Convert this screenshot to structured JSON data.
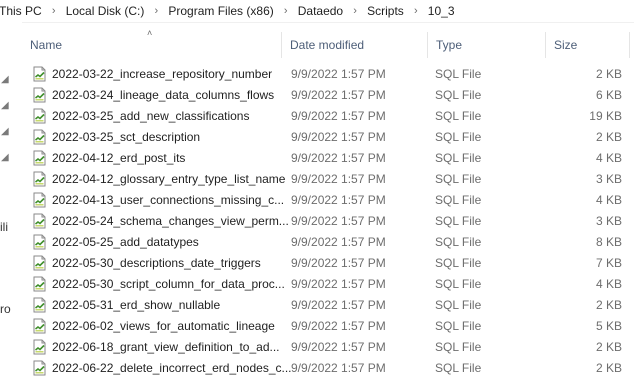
{
  "breadcrumb": [
    "This PC",
    "Local Disk (C:)",
    "Program Files (x86)",
    "Dataedo",
    "Scripts",
    "10_3"
  ],
  "left_pane": {
    "fragment_1": "ili",
    "fragment_2": "ro"
  },
  "columns": {
    "name": "Name",
    "date_modified": "Date modified",
    "type": "Type",
    "size": "Size"
  },
  "files": [
    {
      "name": "2022-03-22_increase_repository_number",
      "date": "9/9/2022 1:57 PM",
      "type": "SQL File",
      "size": "2 KB"
    },
    {
      "name": "2022-03-24_lineage_data_columns_flows",
      "date": "9/9/2022 1:57 PM",
      "type": "SQL File",
      "size": "6 KB"
    },
    {
      "name": "2022-03-25_add_new_classifications",
      "date": "9/9/2022 1:57 PM",
      "type": "SQL File",
      "size": "19 KB"
    },
    {
      "name": "2022-03-25_sct_description",
      "date": "9/9/2022 1:57 PM",
      "type": "SQL File",
      "size": "2 KB"
    },
    {
      "name": "2022-04-12_erd_post_its",
      "date": "9/9/2022 1:57 PM",
      "type": "SQL File",
      "size": "4 KB"
    },
    {
      "name": "2022-04-12_glossary_entry_type_list_name",
      "date": "9/9/2022 1:57 PM",
      "type": "SQL File",
      "size": "3 KB"
    },
    {
      "name": "2022-04-13_user_connections_missing_c...",
      "date": "9/9/2022 1:57 PM",
      "type": "SQL File",
      "size": "4 KB"
    },
    {
      "name": "2022-05-24_schema_changes_view_perm...",
      "date": "9/9/2022 1:57 PM",
      "type": "SQL File",
      "size": "3 KB"
    },
    {
      "name": "2022-05-25_add_datatypes",
      "date": "9/9/2022 1:57 PM",
      "type": "SQL File",
      "size": "8 KB"
    },
    {
      "name": "2022-05-30_descriptions_date_triggers",
      "date": "9/9/2022 1:57 PM",
      "type": "SQL File",
      "size": "7 KB"
    },
    {
      "name": "2022-05-30_script_column_for_data_proc...",
      "date": "9/9/2022 1:57 PM",
      "type": "SQL File",
      "size": "4 KB"
    },
    {
      "name": "2022-05-31_erd_show_nullable",
      "date": "9/9/2022 1:57 PM",
      "type": "SQL File",
      "size": "2 KB"
    },
    {
      "name": "2022-06-02_views_for_automatic_lineage",
      "date": "9/9/2022 1:57 PM",
      "type": "SQL File",
      "size": "5 KB"
    },
    {
      "name": "2022-06-18_grant_view_definition_to_ad...",
      "date": "9/9/2022 1:57 PM",
      "type": "SQL File",
      "size": "2 KB"
    },
    {
      "name": "2022-06-22_delete_incorrect_erd_nodes_c...",
      "date": "9/9/2022 1:57 PM",
      "type": "SQL File",
      "size": "2 KB"
    }
  ],
  "colors": {
    "header_text": "#4d5e78",
    "secondary_text": "#6d6d6d",
    "icon_green": "#3f8f2a"
  },
  "icons": {
    "file": "sql-file-icon",
    "chevron": "chevron-right-icon",
    "pin": "pin-icon",
    "sort": "sort-up-icon"
  }
}
